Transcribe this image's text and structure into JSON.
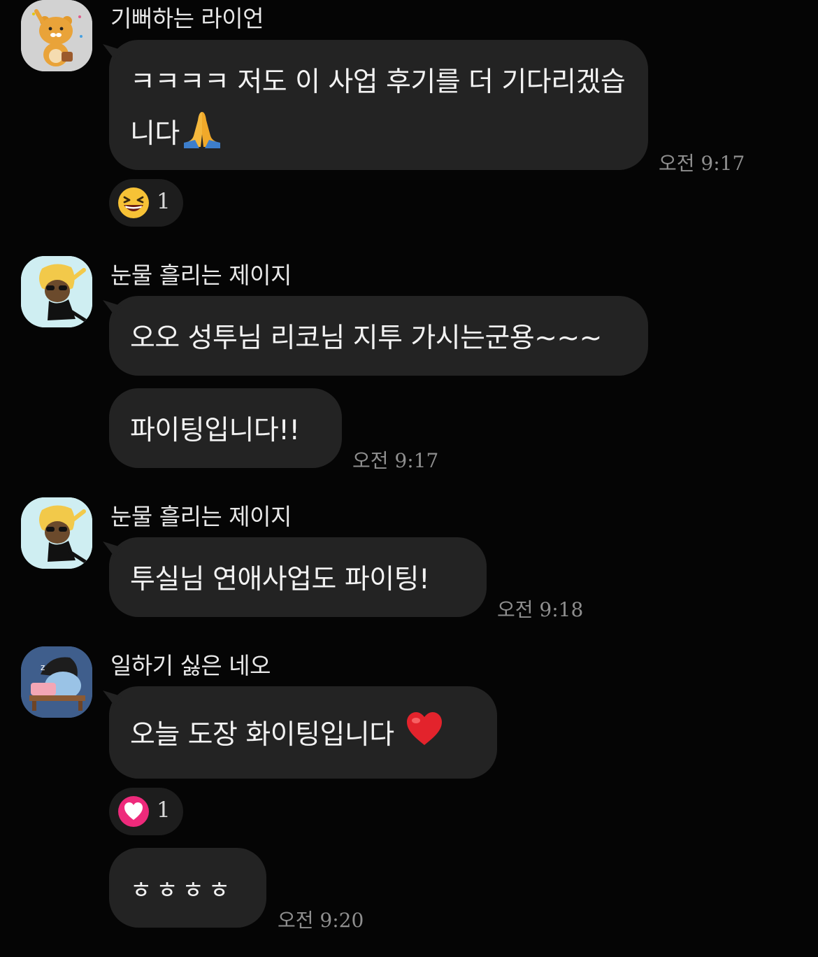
{
  "messages": [
    {
      "sender": "기뻐하는 라이언",
      "avatar_icon": "ryan-avatar-icon",
      "bubbles": [
        {
          "text": "ㅋㅋㅋㅋ 저도 이 사업 후기를 더 기다리겠습니다",
          "emoji": "folded-hands-icon"
        }
      ],
      "time": "오전 9:17",
      "reaction": {
        "icon": "grinning-squint-face-icon",
        "count": "1"
      }
    },
    {
      "sender": "눈물 흘리는 제이지",
      "avatar_icon": "jay-g-avatar-icon",
      "bubbles": [
        {
          "text": "오오 성투님 리코님 지투 가시는군용~~~"
        },
        {
          "text": "파이팅입니다!!"
        }
      ],
      "time": "오전 9:17"
    },
    {
      "sender": "눈물 흘리는 제이지",
      "avatar_icon": "jay-g-avatar-icon",
      "bubbles": [
        {
          "text": "투실님 연애사업도 파이팅!"
        }
      ],
      "time": "오전 9:18"
    },
    {
      "sender": "일하기 싫은 네오",
      "avatar_icon": "neo-avatar-icon",
      "bubbles": [
        {
          "text": "오늘 도장 화이팅입니다",
          "emoji": "red-heart-icon"
        },
        {
          "text": "ㅎㅎㅎㅎ"
        }
      ],
      "time": "오전 9:20",
      "reaction": {
        "icon": "heart-icon",
        "count": "1"
      }
    }
  ],
  "colors": {
    "background": "#050505",
    "bubble": "#232323",
    "time_text": "#8f8f8f",
    "reaction_bg": "#1d1d1d"
  }
}
